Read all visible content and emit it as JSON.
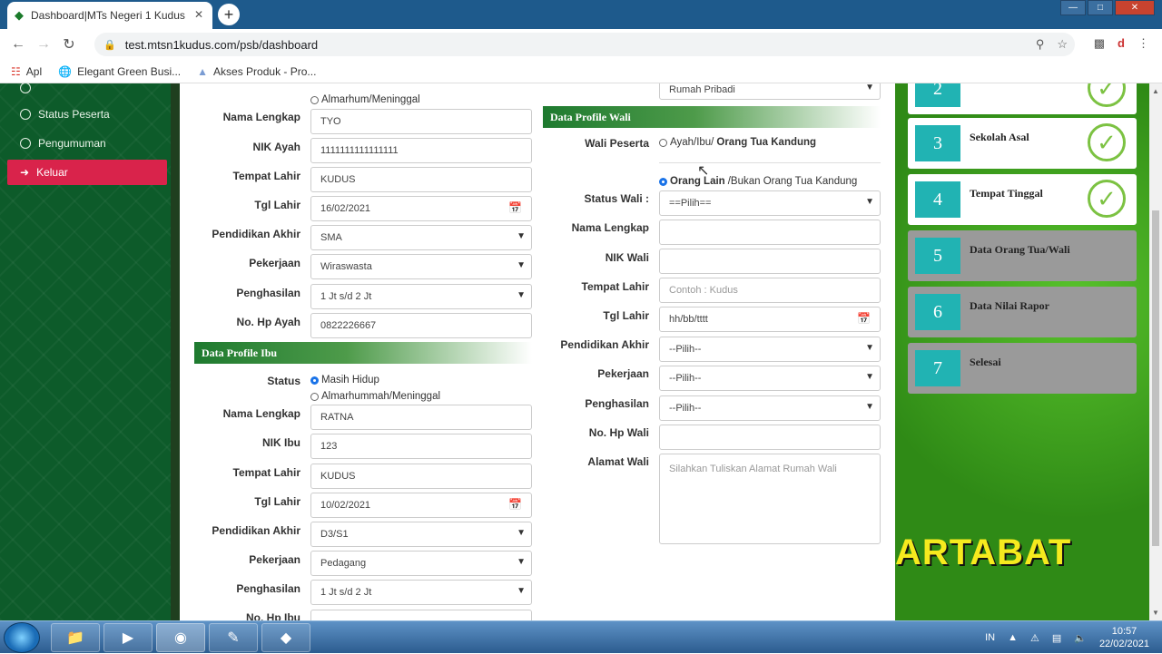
{
  "browser": {
    "tab_title": "Dashboard|MTs Negeri 1 Kudus",
    "url": "test.mtsn1kudus.com/psb/dashboard",
    "bookmarks": [
      "Apl",
      "Elegant Green Busi...",
      "Akses Produk - Pro..."
    ]
  },
  "sidebar": {
    "items": [
      {
        "label": "Status Peserta",
        "icon": "circle-icon"
      },
      {
        "label": "Pengumuman",
        "icon": "circle-icon"
      },
      {
        "label": "Keluar",
        "icon": "logout-icon"
      }
    ]
  },
  "ayah": {
    "status_option2": "Almarhum/Meninggal",
    "nama_label": "Nama Lengkap",
    "nama": "TYO",
    "nik_label": "NIK Ayah",
    "nik": "1111111111111111",
    "tempat_label": "Tempat Lahir",
    "tempat": "KUDUS",
    "tgl_label": "Tgl Lahir",
    "tgl": "16/02/2021",
    "pendidikan_label": "Pendidikan Akhir",
    "pendidikan": "SMA",
    "pekerjaan_label": "Pekerjaan",
    "pekerjaan": "Wiraswasta",
    "penghasilan_label": "Penghasilan",
    "penghasilan": "1 Jt s/d 2 Jt",
    "hp_label": "No. Hp Ayah",
    "hp": "0822226667"
  },
  "ibu": {
    "section_title": "Data Profile Ibu",
    "status_label": "Status",
    "status_option1": "Masih Hidup",
    "status_option2": "Almarhummah/Meninggal",
    "nama_label": "Nama Lengkap",
    "nama": "RATNA",
    "nik_label": "NIK Ibu",
    "nik": "123",
    "tempat_label": "Tempat Lahir",
    "tempat": "KUDUS",
    "tgl_label": "Tgl Lahir",
    "tgl": "10/02/2021",
    "pendidikan_label": "Pendidikan Akhir",
    "pendidikan": "D3/S1",
    "pekerjaan_label": "Pekerjaan",
    "pekerjaan": "Pedagang",
    "penghasilan_label": "Penghasilan",
    "penghasilan": "1 Jt s/d 2 Jt",
    "hp_label": "No. Hp Ibu"
  },
  "wali": {
    "top_select": "Rumah Pribadi",
    "section_title": "Data Profile Wali",
    "peserta_label": "Wali Peserta",
    "option1_prefix": "Ayah/Ibu/",
    "option1_bold": "Orang Tua Kandung",
    "option2_bold": "Orang Lain",
    "option2_suffix": "/Bukan Orang Tua Kandung",
    "status_label": "Status Wali :",
    "status": "==Pilih==",
    "nama_label": "Nama Lengkap",
    "nik_label": "NIK Wali",
    "tempat_label": "Tempat Lahir",
    "tempat_placeholder": "Contoh : Kudus",
    "tgl_label": "Tgl Lahir",
    "tgl_placeholder": "hh/bb/tttt",
    "pendidikan_label": "Pendidikan Akhir",
    "pendidikan": "--Pilih--",
    "pekerjaan_label": "Pekerjaan",
    "pekerjaan": "--Pilih--",
    "penghasilan_label": "Penghasilan",
    "penghasilan": "--Pilih--",
    "hp_label": "No. Hp Wali",
    "alamat_label": "Alamat Wali",
    "alamat_placeholder": "Silahkan Tuliskan Alamat Rumah Wali"
  },
  "steps": [
    {
      "num": "2",
      "label": "",
      "done": true
    },
    {
      "num": "3",
      "label": "Sekolah Asal",
      "done": true
    },
    {
      "num": "4",
      "label": "Tempat Tinggal",
      "done": true
    },
    {
      "num": "5",
      "label": "Data Orang Tua/Wali",
      "done": false
    },
    {
      "num": "6",
      "label": "Data Nilai Rapor",
      "done": false
    },
    {
      "num": "7",
      "label": "Selesai",
      "done": false
    }
  ],
  "brand_text": "ARTABAT",
  "taskbar": {
    "lang": "IN",
    "time": "10:57",
    "date": "22/02/2021"
  },
  "colors": {
    "accent_red": "#d9234b",
    "section_green": "#1e7a2f",
    "step_teal": "#21b3b3",
    "check_green": "#7cc242"
  }
}
